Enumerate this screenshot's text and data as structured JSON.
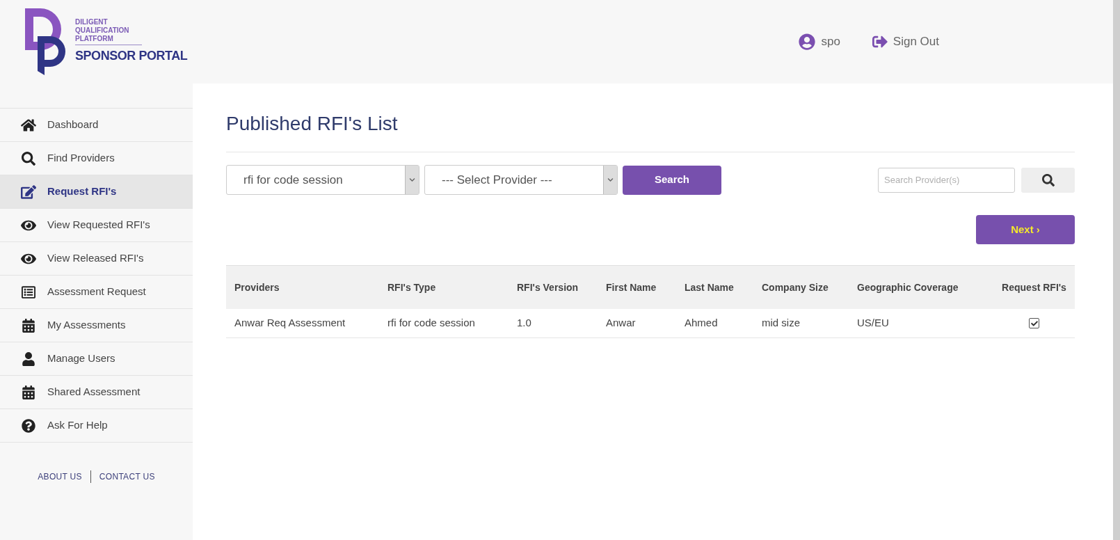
{
  "logo": {
    "lines": [
      "DILIGENT",
      "QUALIFICATION",
      "PLATFORM"
    ],
    "portal": "SPONSOR PORTAL"
  },
  "header": {
    "user": "spo",
    "sign_out": "Sign Out"
  },
  "sidebar": {
    "items": [
      {
        "label": "Dashboard",
        "selected": false
      },
      {
        "label": "Find Providers",
        "selected": false
      },
      {
        "label": "Request RFI's",
        "selected": true
      },
      {
        "label": "View Requested RFI's",
        "selected": false
      },
      {
        "label": "View Released RFI's",
        "selected": false
      },
      {
        "label": "Assessment Request",
        "selected": false
      },
      {
        "label": "My Assessments",
        "selected": false
      },
      {
        "label": "Manage Users",
        "selected": false
      },
      {
        "label": "Shared Assessment",
        "selected": false
      },
      {
        "label": "Ask For Help",
        "selected": false
      }
    ],
    "footer_links": [
      "ABOUT US",
      "CONTACT US"
    ]
  },
  "page": {
    "title": "Published RFI's List",
    "rfi_select": {
      "value": "rfi for code session"
    },
    "provider_select": {
      "value": "--- Select Provider ---"
    },
    "search_button": "Search",
    "search_field": {
      "placeholder": "Search Provider(s)"
    },
    "next_button": "Next ›",
    "table": {
      "columns": [
        "Providers",
        "RFI's Type",
        "RFI's Version",
        "First Name",
        "Last Name",
        "Company Size",
        "Geographic Coverage",
        "Request RFI's"
      ],
      "rows": [
        {
          "cells": [
            "Anwar Req Assessment",
            "rfi for code session",
            "1.0",
            "Anwar",
            "Ahmed",
            "mid size",
            "US/EU"
          ],
          "checked": true
        }
      ]
    }
  }
}
